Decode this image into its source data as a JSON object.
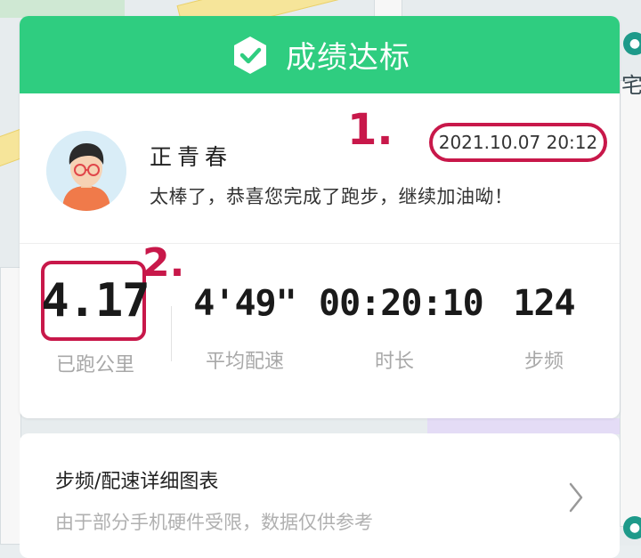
{
  "header": {
    "title": "成绩达标",
    "accent_color": "#2fcd80",
    "icon": "check-shield-icon"
  },
  "user": {
    "name": "正青春",
    "message": "太棒了，恭喜您完成了跑步，继续加油呦！",
    "datetime": "2021.10.07 20:12",
    "avatar_icon": "user-avatar-icon"
  },
  "annotations": {
    "one": "1.",
    "two": "2.",
    "color": "#c8184a"
  },
  "stats": [
    {
      "value": "4.17",
      "label": "已跑公里"
    },
    {
      "value": "4'49\"",
      "label": "平均配速"
    },
    {
      "value": "00:20:10",
      "label": "时长"
    },
    {
      "value": "124",
      "label": "步频"
    }
  ],
  "detail": {
    "title": "步频/配速详细图表",
    "subtitle": "由于部分手机硬件受限，数据仅供参考",
    "icon": "chevron-right-icon"
  },
  "map": {
    "label": "宅"
  }
}
